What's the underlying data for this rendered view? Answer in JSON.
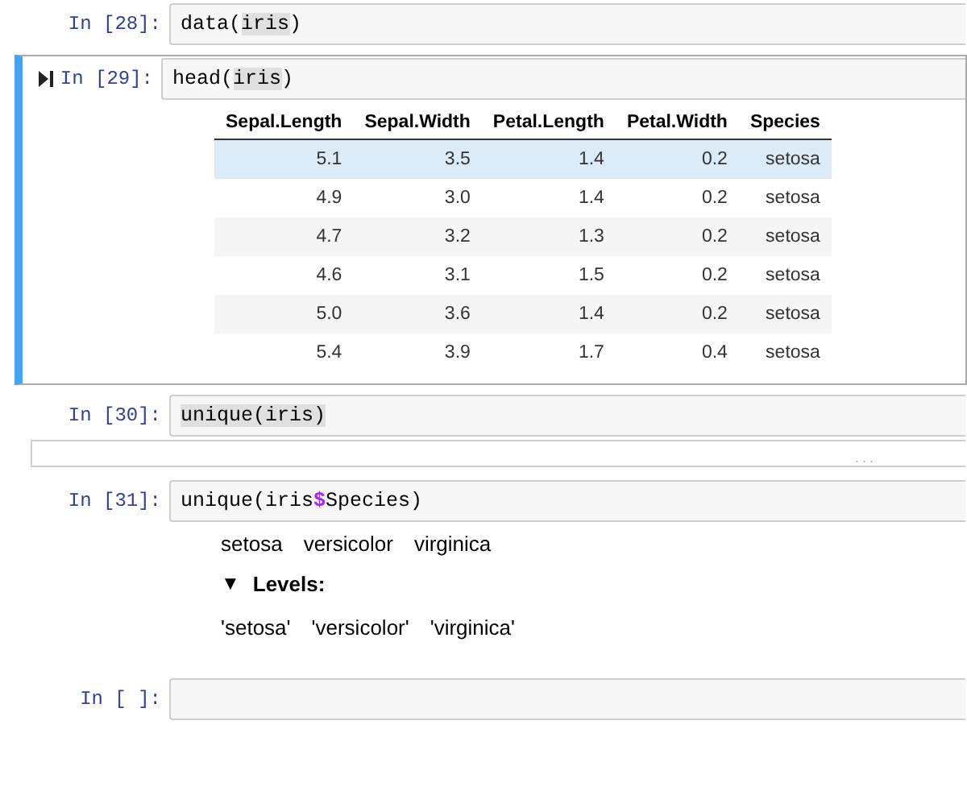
{
  "cells": [
    {
      "prompt": "In [28]:",
      "selected": false,
      "code": [
        {
          "text": "data(",
          "kind": "plain"
        },
        {
          "text": "iris",
          "kind": "match"
        },
        {
          "text": ")",
          "kind": "plain"
        }
      ]
    },
    {
      "prompt": "In [29]:",
      "selected": true,
      "code": [
        {
          "text": "head(",
          "kind": "plain"
        },
        {
          "text": "iris",
          "kind": "match"
        },
        {
          "text": ")",
          "kind": "plain"
        }
      ],
      "outputs": [
        {
          "kind": "table",
          "columns": [
            "Sepal.Length",
            "Sepal.Width",
            "Petal.Length",
            "Petal.Width",
            "Species"
          ],
          "rows": [
            {
              "cells": [
                "5.1",
                "3.5",
                "1.4",
                "0.2",
                "setosa"
              ],
              "highlighted": true
            },
            {
              "cells": [
                "4.9",
                "3.0",
                "1.4",
                "0.2",
                "setosa"
              ],
              "highlighted": false
            },
            {
              "cells": [
                "4.7",
                "3.2",
                "1.3",
                "0.2",
                "setosa"
              ],
              "highlighted": false
            },
            {
              "cells": [
                "4.6",
                "3.1",
                "1.5",
                "0.2",
                "setosa"
              ],
              "highlighted": false
            },
            {
              "cells": [
                "5.0",
                "3.6",
                "1.4",
                "0.2",
                "setosa"
              ],
              "highlighted": false
            },
            {
              "cells": [
                "5.4",
                "3.9",
                "1.7",
                "0.4",
                "setosa"
              ],
              "highlighted": false
            }
          ]
        }
      ]
    },
    {
      "prompt": "In [30]:",
      "selected": false,
      "code": [
        {
          "text": "unique(iris)",
          "kind": "match"
        }
      ],
      "outputs": [
        {
          "kind": "collapsed",
          "text": "..."
        }
      ]
    },
    {
      "prompt": "In [31]:",
      "selected": false,
      "code": [
        {
          "text": "unique(iris",
          "kind": "plain"
        },
        {
          "text": "$",
          "kind": "operator"
        },
        {
          "text": "Species)",
          "kind": "plain"
        }
      ],
      "outputs": [
        {
          "kind": "factor",
          "values": [
            "setosa",
            "versicolor",
            "virginica"
          ],
          "toggle": "▼",
          "levels_label": "Levels",
          "levels_colon": ":",
          "levels": [
            "'setosa'",
            "'versicolor'",
            "'virginica'"
          ]
        }
      ]
    },
    {
      "prompt": "In [ ]:",
      "selected": false
    }
  ]
}
